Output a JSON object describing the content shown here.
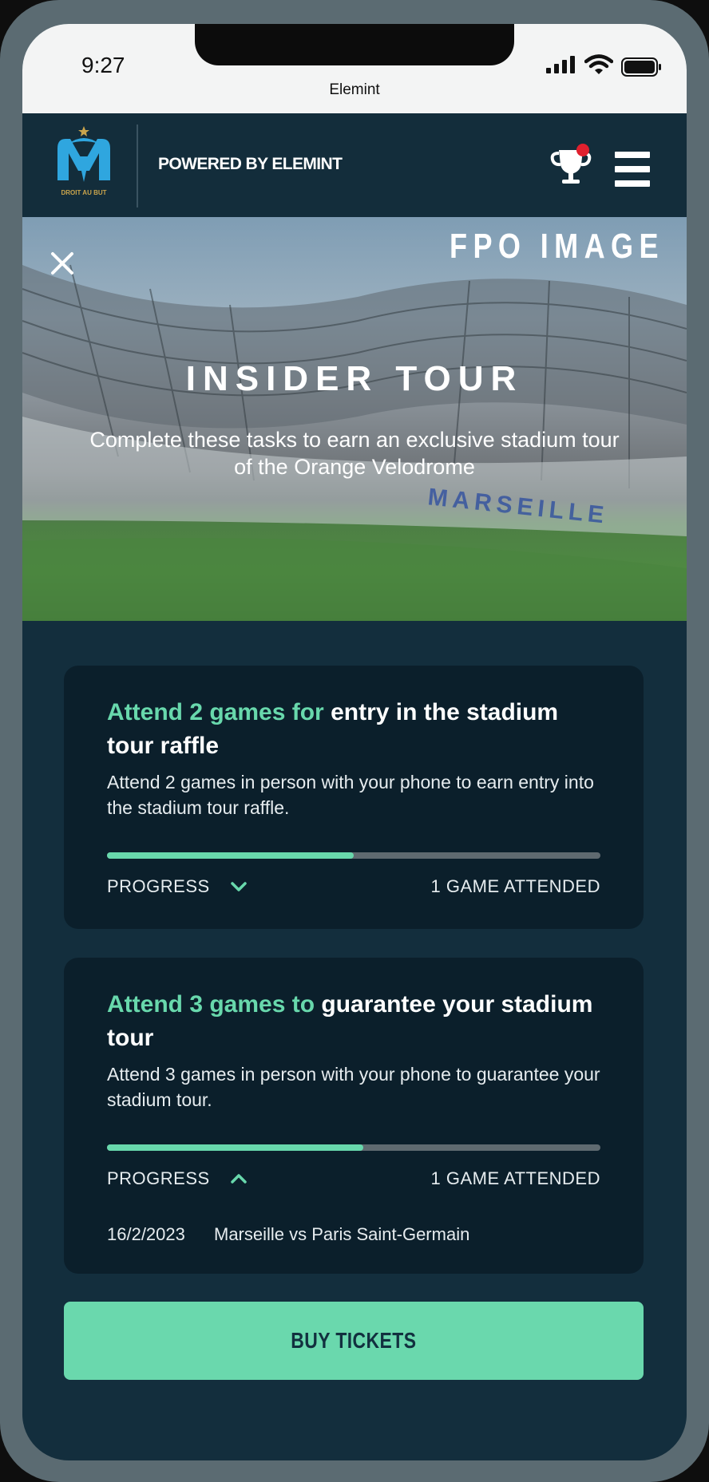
{
  "status_bar": {
    "time": "9:27",
    "app_name": "Elemint"
  },
  "header": {
    "logo_text": "DROIT AU BUT",
    "powered_by": "POWERED BY ELEMINT",
    "icons": [
      "trophy-icon",
      "menu-icon"
    ]
  },
  "hero": {
    "fpo_label": "FPO IMAGE",
    "title": "INSIDER TOUR",
    "subtitle": "Complete these tasks to earn an exclusive stadium tour of the Orange Velodrome",
    "stadium_text": "MARSEILLE"
  },
  "tasks": [
    {
      "title_accent": "Attend 2 games for",
      "title_rest": "entry in the stadium tour raffle",
      "description": "Attend 2 games in person with your phone to earn entry into the stadium tour raffle.",
      "progress_label": "PROGRESS",
      "progress_fraction": 0.5,
      "progress_count": "1 GAME ATTENDED",
      "expanded": false
    },
    {
      "title_accent": "Attend 3 games to",
      "title_rest": "guarantee your stadium tour",
      "description": "Attend 3 games in person with your phone to guarantee your stadium tour.",
      "progress_label": "PROGRESS",
      "progress_fraction": 0.52,
      "progress_count": "1 GAME ATTENDED",
      "expanded": true,
      "games": [
        {
          "date": "16/2/2023",
          "match": "Marseille vs Paris Saint-Germain"
        }
      ]
    }
  ],
  "buy_button": "BUY TICKETS",
  "colors": {
    "background": "#132e3d",
    "card": "#0b1f2b",
    "accent": "#68d8ac",
    "notification": "#e0202e"
  }
}
